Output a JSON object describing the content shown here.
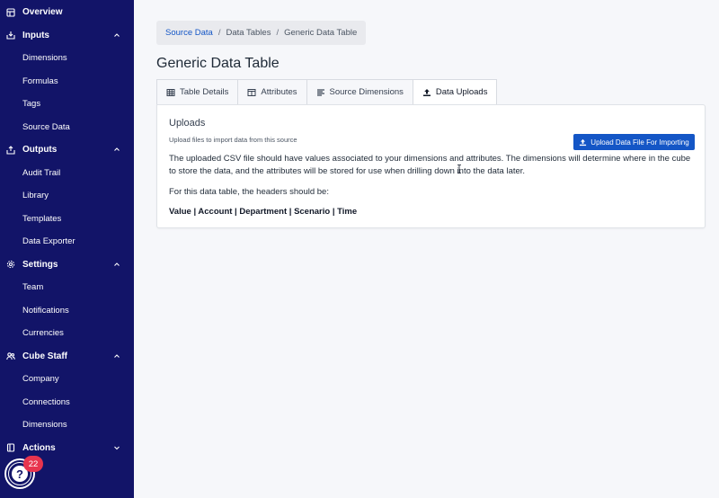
{
  "sidebar": {
    "overview": "Overview",
    "inputs": {
      "label": "Inputs",
      "items": [
        "Dimensions",
        "Formulas",
        "Tags",
        "Source Data"
      ]
    },
    "outputs": {
      "label": "Outputs",
      "items": [
        "Audit Trail",
        "Library",
        "Templates",
        "Data Exporter"
      ]
    },
    "settings": {
      "label": "Settings",
      "items": [
        "Team",
        "Notifications",
        "Currencies"
      ]
    },
    "cube_staff": {
      "label": "Cube Staff",
      "items": [
        "Company",
        "Connections",
        "Dimensions"
      ]
    },
    "actions": {
      "label": "Actions"
    }
  },
  "help": {
    "badge": "22",
    "icon": "?"
  },
  "breadcrumb": {
    "items": [
      "Source Data",
      "Data Tables",
      "Generic Data Table"
    ],
    "separator": "/"
  },
  "page": {
    "title": "Generic Data Table"
  },
  "tabs": [
    {
      "label": "Table Details",
      "icon": "table-icon"
    },
    {
      "label": "Attributes",
      "icon": "columns-icon"
    },
    {
      "label": "Source Dimensions",
      "icon": "list-icon"
    },
    {
      "label": "Data Uploads",
      "icon": "upload-icon",
      "active": true
    }
  ],
  "uploads": {
    "title": "Uploads",
    "subtitle": "Upload files to import data from this source",
    "button_label": "Upload Data File For Importing",
    "description": "The uploaded CSV file should have values associated to your dimensions and attributes. The dimensions will determine where in the cube to store the data, and the attributes will be stored for use when drilling down into the data later.",
    "note": "For this data table, the headers should be:",
    "headers": "Value | Account | Department | Scenario | Time"
  },
  "colors": {
    "sidebar_bg": "#121468",
    "primary": "#1456c6",
    "badge": "#e8344e",
    "page_bg": "#f6f7fa"
  }
}
